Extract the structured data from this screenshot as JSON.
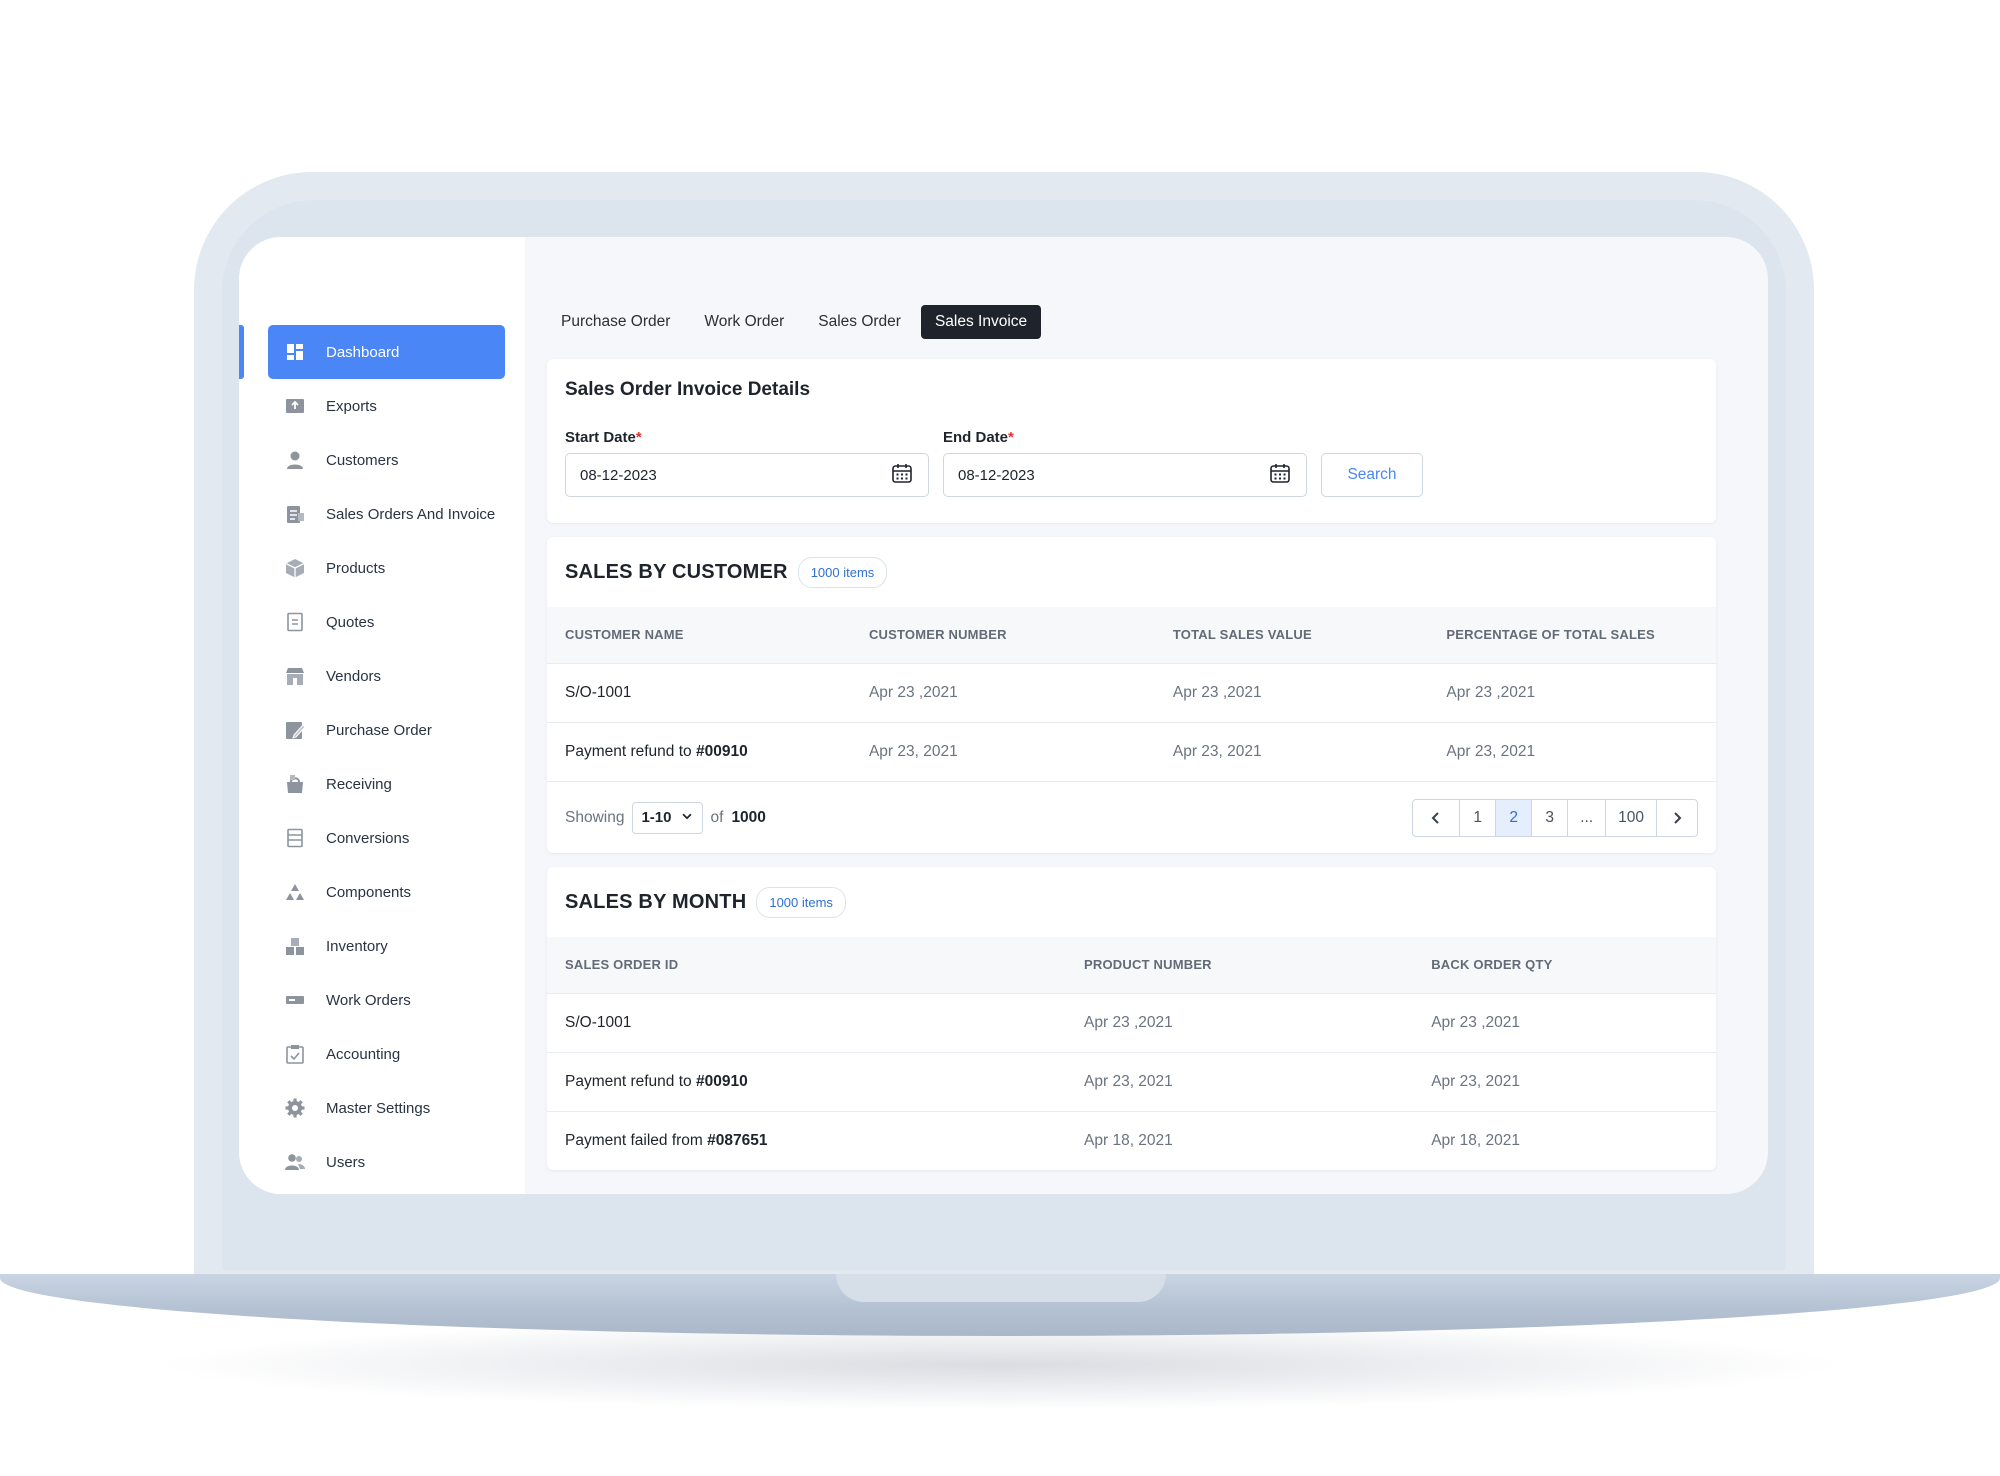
{
  "sidebar": {
    "items": [
      {
        "label": "Dashboard",
        "icon": "dashboard-icon"
      },
      {
        "label": "Exports",
        "icon": "exports-icon"
      },
      {
        "label": "Customers",
        "icon": "customers-icon"
      },
      {
        "label": "Sales Orders And Invoice",
        "icon": "sales-orders-icon"
      },
      {
        "label": "Products",
        "icon": "products-icon"
      },
      {
        "label": "Quotes",
        "icon": "quotes-icon"
      },
      {
        "label": "Vendors",
        "icon": "vendors-icon"
      },
      {
        "label": "Purchase Order",
        "icon": "purchase-order-icon"
      },
      {
        "label": "Receiving",
        "icon": "receiving-icon"
      },
      {
        "label": "Conversions",
        "icon": "conversions-icon"
      },
      {
        "label": "Components",
        "icon": "components-icon"
      },
      {
        "label": "Inventory",
        "icon": "inventory-icon"
      },
      {
        "label": "Work Orders",
        "icon": "work-orders-icon"
      },
      {
        "label": "Accounting",
        "icon": "accounting-icon"
      },
      {
        "label": "Master Settings",
        "icon": "gear-icon"
      },
      {
        "label": "Users",
        "icon": "users-icon"
      }
    ]
  },
  "tabs": [
    {
      "label": "Purchase Order"
    },
    {
      "label": "Work Order"
    },
    {
      "label": "Sales Order"
    },
    {
      "label": "Sales Invoice"
    }
  ],
  "filters": {
    "title": "Sales Order Invoice Details",
    "start_label": "Start Date",
    "start_value": "08-12-2023",
    "end_label": "End Date",
    "end_value": "08-12-2023",
    "required_mark": "*",
    "search_label": "Search"
  },
  "sales_by_customer": {
    "title": "SALES BY CUSTOMER",
    "badge": "1000 items",
    "columns": [
      "CUSTOMER NAME",
      "CUSTOMER NUMBER",
      "TOTAL SALES VALUE",
      "PERCENTAGE OF TOTAL SALES"
    ],
    "rows": [
      {
        "name": "S/O-1001",
        "name_strong": "",
        "number": "Apr 23 ,2021",
        "total": "Apr 23 ,2021",
        "pct": "Apr 23 ,2021"
      },
      {
        "name": "Payment refund to ",
        "name_strong": "#00910",
        "number": "Apr 23, 2021",
        "total": "Apr 23, 2021",
        "pct": "Apr 23, 2021"
      }
    ],
    "showing_label": "Showing",
    "page_size": "1-10",
    "of_label": "of",
    "total": "1000",
    "pages": [
      "1",
      "2",
      "3",
      "...",
      "100"
    ]
  },
  "sales_by_month": {
    "title": "SALES BY MONTH",
    "badge": "1000 items",
    "columns": [
      "SALES ORDER ID",
      "PRODUCT NUMBER",
      "BACK ORDER QTY"
    ],
    "rows": [
      {
        "id": "S/O-1001",
        "id_strong": "",
        "product": "Apr 23 ,2021",
        "qty": "Apr 23 ,2021"
      },
      {
        "id": "Payment refund to ",
        "id_strong": "#00910",
        "product": "Apr 23, 2021",
        "qty": "Apr 23, 2021"
      },
      {
        "id": "Payment failed from ",
        "id_strong": "#087651",
        "product": "Apr 18, 2021",
        "qty": "Apr 18, 2021"
      }
    ]
  },
  "colors": {
    "accent": "#4a86f5",
    "active_tab": "#1f242c",
    "required": "#e03131"
  }
}
